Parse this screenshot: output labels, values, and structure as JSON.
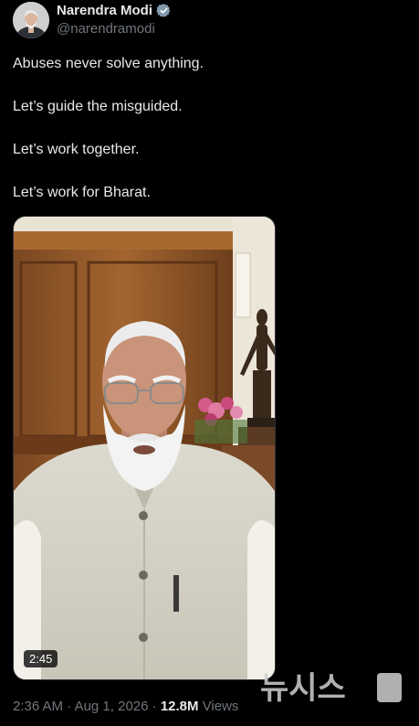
{
  "author": {
    "display_name": "Narendra Modi",
    "handle": "@narendramodi",
    "verified_icon": "verified-badge-icon",
    "badge_color": "#829aab"
  },
  "tweet": {
    "lines": [
      "Abuses never solve anything.",
      "Let’s guide the misguided.",
      "Let’s work together.",
      "Let’s work for Bharat."
    ]
  },
  "media": {
    "type": "video",
    "duration": "2:45"
  },
  "meta": {
    "time": "2:36 AM",
    "separator": "·",
    "date": "Aug 1, 2026",
    "views_count": "12.8M",
    "views_label": "Views"
  },
  "watermark": {
    "text": "뉴시스"
  }
}
